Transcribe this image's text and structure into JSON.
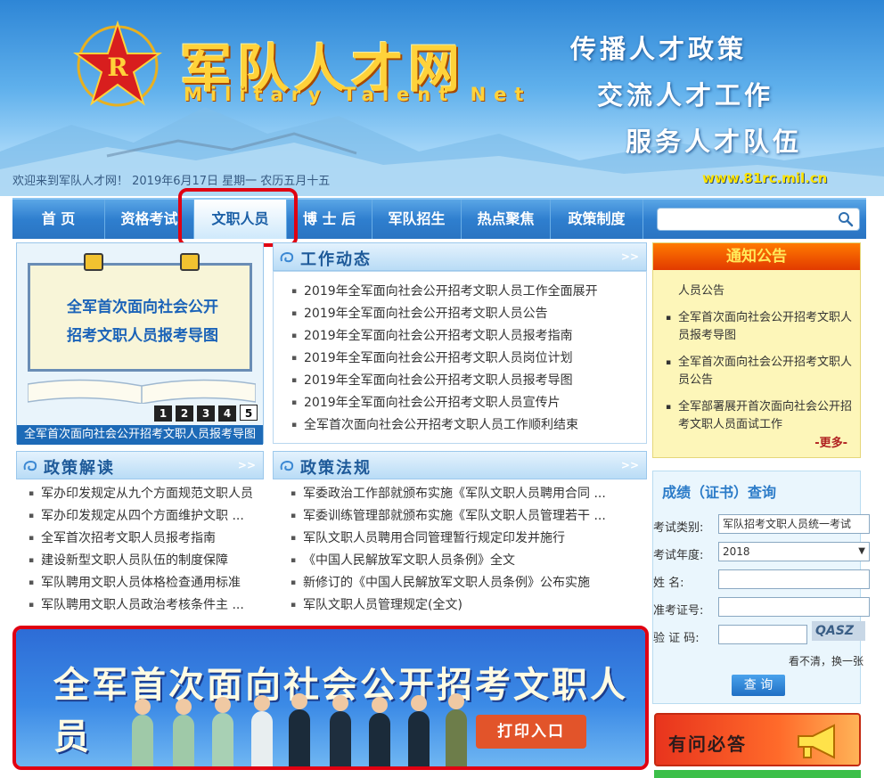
{
  "header": {
    "site_title": "军队人才网",
    "site_subtitle": "Military Talent Net",
    "slogans": [
      "传播人才政策",
      "交流人才工作",
      "服务人才队伍"
    ],
    "welcome": "欢迎来到军队人才网！ 2019年6月17日 星期一 农历五月十五",
    "url": "www.81rc.mil.cn"
  },
  "nav": {
    "items": [
      "首  页",
      "资格考试",
      "文职人员",
      "博 士 后",
      "军队招生",
      "热点聚焦",
      "政策制度"
    ],
    "active": "文职人员",
    "search_placeholder": ""
  },
  "slider": {
    "board_line1": "全军首次面向社会公开",
    "board_line2": "招考文职人员报考导图",
    "pages": [
      "1",
      "2",
      "3",
      "4",
      "5"
    ],
    "current_page": "5",
    "caption": "全军首次面向社会公开招考文职人员报考导图"
  },
  "work_news": {
    "title": "工作动态",
    "more": ">>",
    "items": [
      "2019年全军面向社会公开招考文职人员工作全面展开",
      "2019年全军面向社会公开招考文职人员公告",
      "2019年全军面向社会公开招考文职人员报考指南",
      "2019年全军面向社会公开招考文职人员岗位计划",
      "2019年全军面向社会公开招考文职人员报考导图",
      "2019年全军面向社会公开招考文职人员宣传片",
      "全军首次面向社会公开招考文职人员工作顺利结束"
    ]
  },
  "policy_read": {
    "title": "政策解读",
    "more": ">>",
    "items": [
      "军办印发规定从九个方面规范文职人员",
      "军办印发规定从四个方面维护文职 ...",
      "全军首次招考文职人员报考指南",
      "建设新型文职人员队伍的制度保障",
      "军队聘用文职人员体格检查通用标准",
      "军队聘用文职人员政治考核条件主 ..."
    ]
  },
  "policy_law": {
    "title": "政策法规",
    "more": ">>",
    "items": [
      "军委政治工作部就颁布实施《军队文职人员聘用合同 ...",
      "军委训练管理部就颁布实施《军队文职人员管理若干 ...",
      "军队文职人员聘用合同管理暂行规定印发并施行",
      "《中国人民解放军文职人员条例》全文",
      "新修订的《中国人民解放军文职人员条例》公布实施",
      "军队文职人员管理规定(全文)"
    ]
  },
  "notice": {
    "title": "通知公告",
    "items": [
      {
        "text": "人员公告",
        "bullet": false
      },
      {
        "text": "全军首次面向社会公开招考文职人员报考导图",
        "bullet": true
      },
      {
        "text": "全军首次面向社会公开招考文职人员公告",
        "bullet": true
      },
      {
        "text": "全军部署展开首次面向社会公开招考文职人员面试工作",
        "bullet": true
      }
    ],
    "more": "-更多-"
  },
  "score_query": {
    "title": "成绩（证书）查询",
    "exam_type_label": "考试类别:",
    "exam_type_value": "军队招考文职人员统一考试",
    "exam_year_label": "考试年度:",
    "exam_year_value": "2018",
    "name_label": "姓    名:",
    "ticket_label": "准考证号:",
    "captcha_label": "验 证 码:",
    "captcha_text": "QASZ",
    "captcha_tip": "看不清，换一张",
    "query_button": "查 询"
  },
  "faq": {
    "label": "有问必答"
  },
  "banner": {
    "title": "全军首次面向社会公开招考文职人员",
    "print_button": "打印入口"
  },
  "colors": {
    "nav_blue": "#2f7fcf",
    "highlight_red": "#e00012",
    "notice_orange": "#e23a00",
    "title_gold": "#ffd23a"
  }
}
